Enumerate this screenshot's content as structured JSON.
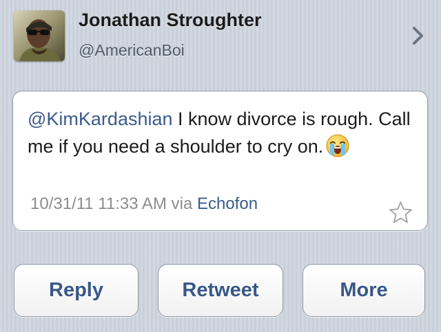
{
  "profile": {
    "display_name": "Jonathan Stroughter",
    "handle": "@AmericanBoi"
  },
  "tweet": {
    "mention": "@KimKardashian",
    "text": " I know divorce is rough. Call me if you need a shoulder to cry on.",
    "emoji": "loudly-crying-face",
    "timestamp": "10/31/11 11:33 AM",
    "via_label": "via",
    "client": "Echofon"
  },
  "actions": {
    "reply_label": "Reply",
    "retweet_label": "Retweet",
    "more_label": "More"
  },
  "colors": {
    "background": "#c9d0da",
    "link": "#3b5b8a",
    "button_text": "#385887",
    "meta_text": "#8c8c8c"
  }
}
